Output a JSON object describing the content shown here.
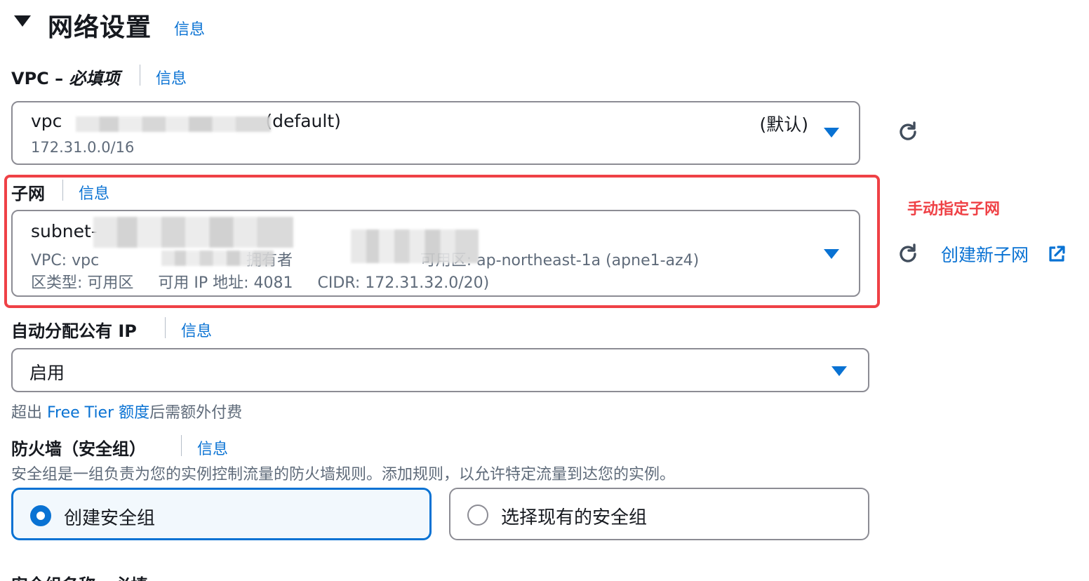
{
  "header": {
    "title": "网络设置",
    "info": "信息"
  },
  "vpc": {
    "label_prefix": "VPC – ",
    "label_required": "必填项",
    "info": "信息",
    "selected_prefix": "vpc",
    "selected_suffix": "(default)",
    "cidr": "172.31.0.0/16",
    "default_badge": "(默认)"
  },
  "subnet": {
    "label": "子网",
    "info": "信息",
    "selected_prefix": "subnet-",
    "line2": "VPC: vpc                              拥有者                          可用区: ap-northeast-1a (apne1-az4)",
    "line3": "区类型: 可用区     可用 IP 地址: 4081     CIDR: 172.31.32.0/20)",
    "annotation": "手动指定子网",
    "create_link": "创建新子网"
  },
  "public_ip": {
    "label": "自动分配公有 IP",
    "info": "信息",
    "value": "启用",
    "note_prefix": "超出 ",
    "note_link": "Free Tier 额度",
    "note_suffix": "后需额外付费"
  },
  "firewall": {
    "label": "防火墙（安全组）",
    "info": "信息",
    "description": "安全组是一组负责为您的实例控制流量的防火墙规则。添加规则，以允许特定流量到达您的实例。",
    "options": [
      {
        "label": "创建安全组",
        "selected": true
      },
      {
        "label": "选择现有的安全组",
        "selected": false
      }
    ]
  },
  "sg_name": {
    "label": "安全组名称 - 必填"
  },
  "colors": {
    "accent": "#0972d3",
    "highlight": "#ef4146",
    "border": "#8c8c94",
    "muted": "#5f6b7a"
  },
  "icons": [
    "caret-down-icon",
    "refresh-icon",
    "external-link-icon",
    "radio-icon"
  ]
}
